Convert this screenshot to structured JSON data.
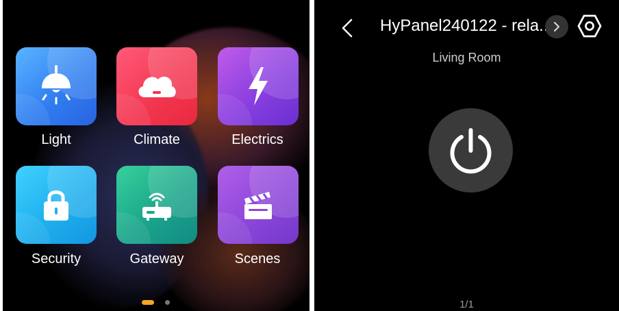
{
  "left_screen": {
    "tiles": [
      {
        "label": "Light",
        "icon": "lamp-icon",
        "color": "#3a8ef6"
      },
      {
        "label": "Climate",
        "icon": "cloud-icon",
        "color": "#f23d5c"
      },
      {
        "label": "Electrics",
        "icon": "lightning-bolt-icon",
        "color": "#8a3fe0"
      },
      {
        "label": "Security",
        "icon": "lock-icon",
        "color": "#22b6ee"
      },
      {
        "label": "Gateway",
        "icon": "router-icon",
        "color": "#1fae8c"
      },
      {
        "label": "Scenes",
        "icon": "clapperboard-icon",
        "color": "#8d46d9"
      }
    ],
    "page_dots": {
      "active": 1,
      "count": 2,
      "active_color": "#f5a623"
    }
  },
  "right_screen": {
    "title": "HyPanel240122 - rela...",
    "room": "Living Room",
    "pager": "1/1",
    "power_state": "off"
  }
}
